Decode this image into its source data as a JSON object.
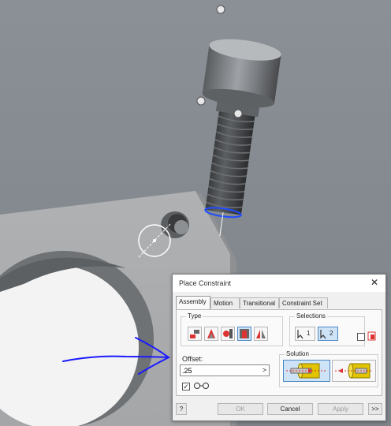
{
  "dialog": {
    "title": "Place Constraint",
    "close_symbol": "✕",
    "tabs": [
      {
        "label": "Assembly",
        "active": true
      },
      {
        "label": "Motion",
        "active": false
      },
      {
        "label": "Transitional",
        "active": false
      },
      {
        "label": "Constraint Set",
        "active": false
      }
    ],
    "type_group": {
      "label": "Type",
      "buttons": [
        {
          "icon": "mate-constraint-icon",
          "selected": false
        },
        {
          "icon": "angle-constraint-icon",
          "selected": false
        },
        {
          "icon": "tangent-constraint-icon",
          "selected": false
        },
        {
          "icon": "insert-constraint-icon",
          "selected": true
        },
        {
          "icon": "symmetry-constraint-icon",
          "selected": false
        }
      ]
    },
    "selections_group": {
      "label": "Selections",
      "first_label": "1",
      "second_label": "2",
      "pick_part_first": false
    },
    "offset": {
      "label": "Offset:",
      "value": ".25",
      "arrow": ">"
    },
    "solution_group": {
      "label": "Solution",
      "options": [
        {
          "icon": "opposed-solution-icon",
          "selected": true
        },
        {
          "icon": "aligned-solution-icon",
          "selected": false
        }
      ]
    },
    "preview_checked": true,
    "buttons": {
      "help": "?",
      "ok": "OK",
      "cancel": "Cancel",
      "apply": "Apply",
      "more": ">>"
    }
  },
  "colors": {
    "viewport_background": "#858b91",
    "selection_highlight": "#1f4cff",
    "annotation_arrow": "#1a1aff",
    "active_button": "#cfe3f6"
  }
}
